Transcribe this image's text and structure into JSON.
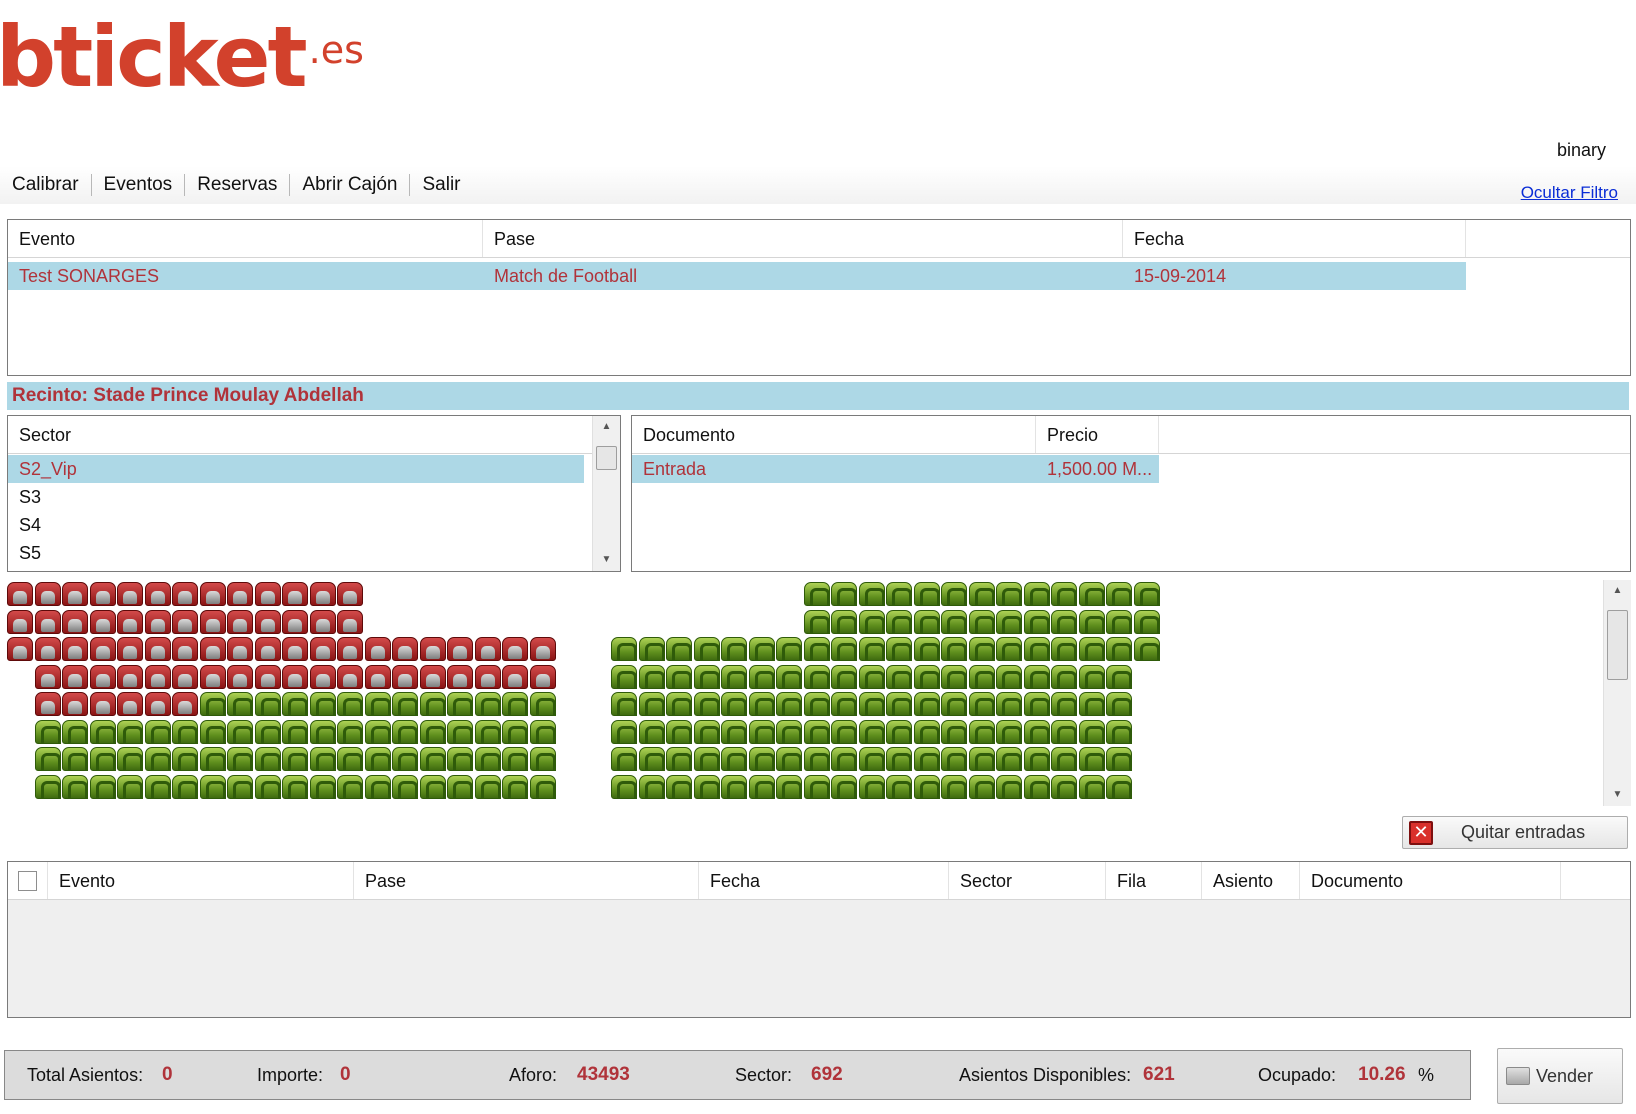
{
  "logo": {
    "main": "bticket",
    "tld": ".es"
  },
  "user": "binary",
  "menu": [
    {
      "label": "Calibrar"
    },
    {
      "label": "Eventos"
    },
    {
      "label": "Reservas"
    },
    {
      "label": "Abrir Cajón"
    },
    {
      "label": "Salir"
    }
  ],
  "hide_filter": "Ocultar Filtro",
  "events_table": {
    "headers": [
      "Evento",
      "Pase",
      "Fecha"
    ],
    "rows": [
      {
        "evento": "Test SONARGES",
        "pase": "Match de Football",
        "fecha": "15-09-2014"
      }
    ]
  },
  "recinto": "Recinto: Stade Prince Moulay Abdellah",
  "sector_list": {
    "header": "Sector",
    "items": [
      "S2_Vip",
      "S3",
      "S4",
      "S5"
    ],
    "selected": "S2_Vip"
  },
  "document_table": {
    "headers": [
      "Documento",
      "Precio"
    ],
    "rows": [
      {
        "documento": "Entrada",
        "precio": "1,500.00 M..."
      }
    ]
  },
  "seat_map": {
    "legend": {
      "free": "green-seat",
      "taken": "red-seat"
    }
  },
  "remove_button": "Quitar entradas",
  "cart_table": {
    "headers": [
      "Evento",
      "Pase",
      "Fecha",
      "Sector",
      "Fila",
      "Asiento",
      "Documento"
    ],
    "rows": []
  },
  "status": {
    "total_label": "Total Asientos:",
    "total_value": "0",
    "importe_label": "Importe:",
    "importe_value": "0",
    "aforo_label": "Aforo:",
    "aforo_value": "43493",
    "sector_label": "Sector:",
    "sector_value": "692",
    "disponibles_label": "Asientos Disponibles:",
    "disponibles_value": "621",
    "ocupado_label": "Ocupado:",
    "ocupado_value": "10.26",
    "ocupado_unit": "%"
  },
  "sell_button": "Vender",
  "colors": {
    "accent": "#d2412c",
    "selection": "#add8e6",
    "selection_text": "#b0333a"
  }
}
